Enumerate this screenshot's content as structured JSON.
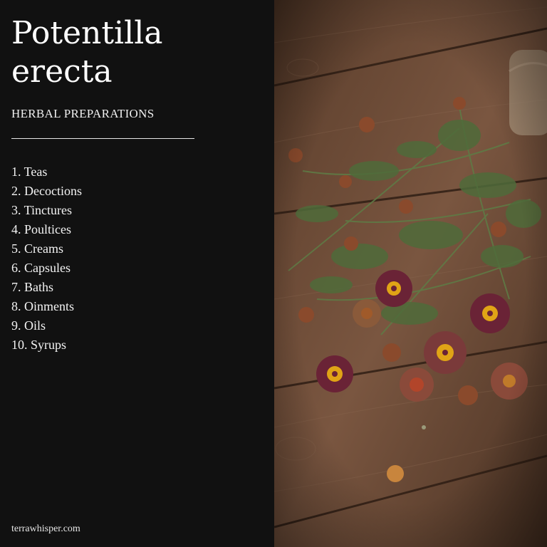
{
  "title": {
    "line1": "Potentilla",
    "line2": "erecta"
  },
  "subtitle": "HERBAL PREPARATIONS",
  "list": [
    "1. Teas",
    "2. Decoctions",
    "3. Tinctures",
    "4. Poultices",
    "5. Creams",
    "6. Capsules",
    "7. Baths",
    "8. Oinments",
    "9. Oils",
    "10. Syrups"
  ],
  "footer": "terrawhisper.com",
  "colors": {
    "panel_background": "#111111",
    "text": "#ffffff",
    "wood": "#6b4a35",
    "petal": "#6a2336",
    "flower_center": "#e0a416",
    "foliage": "#4f6b3a"
  },
  "image": {
    "description_icon": "herb-photo"
  }
}
